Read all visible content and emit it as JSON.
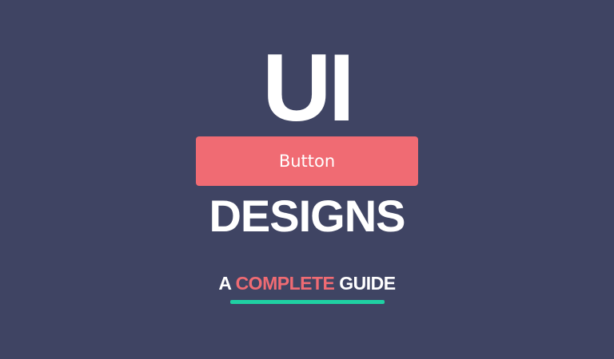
{
  "hero": {
    "title_line1": "UI",
    "button_label": "Button",
    "title_line2": "DESIGNS",
    "subtitle": {
      "part1": "A",
      "highlight": "COMPLETE",
      "part2": "GUIDE"
    }
  },
  "colors": {
    "background": "#3f4463",
    "accent": "#f06b73",
    "underline": "#1fd0a3",
    "text": "#ffffff"
  }
}
